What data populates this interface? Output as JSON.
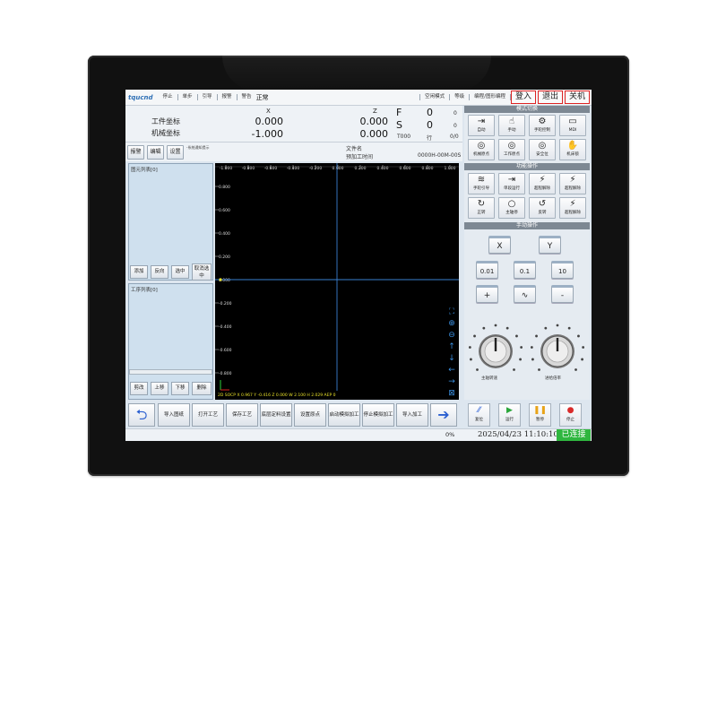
{
  "topbar": {
    "brand": "tqucnd",
    "items": [
      "停止",
      "单步",
      "引导",
      "报警",
      "警告"
    ],
    "state": "正常",
    "right_items": [
      "空闲模式",
      "等级",
      "编程/图形编程"
    ],
    "buttons": {
      "login": "登入",
      "exit": "退出",
      "shutdown": "关机"
    }
  },
  "coords": {
    "work_label": "工件坐标",
    "machine_label": "机械坐标",
    "x_header": "X",
    "z_header": "Z",
    "work_x": "0.000",
    "work_z": "0.000",
    "machine_x": "-1.000",
    "machine_z": "0.000",
    "f_label": "F",
    "f_value": "0",
    "f_unit": "0",
    "s_label": "S",
    "s_value": "0",
    "s_unit": "0",
    "t_label": "T000",
    "line_label": "行",
    "line_value": "0/0"
  },
  "row2": {
    "buttons": [
      "报警",
      "编辑",
      "设置"
    ],
    "system_note": "-系统通知提示",
    "file_label": "文件名",
    "time_label": "预加工时间",
    "time_value": "0000H-00M-00S"
  },
  "lists": {
    "element_title": "图元列表[0]",
    "element_buttons": [
      "添加",
      "反向",
      "选中",
      "取消选中"
    ],
    "process_title": "工序列表[0]",
    "process_buttons": [
      "剪改",
      "上移",
      "下移",
      "删除"
    ]
  },
  "canvas": {
    "x_ticks": [
      "-1.000",
      "-0.800",
      "-0.600",
      "-0.400",
      "-0.200",
      "0.000",
      "0.200",
      "0.400",
      "0.600",
      "0.800",
      "1.000"
    ],
    "y_ticks": [
      "0.800",
      "0.600",
      "0.400",
      "0.200",
      "0.000",
      "-0.200",
      "-0.400",
      "-0.600",
      "-0.800"
    ],
    "status": "2D SOCP X  0.967 Y  -0.416 Z    0.000 W    2.100 H    2.029 AEP 0"
  },
  "right": {
    "mode_title": "模式切换",
    "mode_buttons": [
      {
        "icon": "⇥",
        "label": "自动"
      },
      {
        "icon": "☝",
        "label": "手动"
      },
      {
        "icon": "⚙",
        "label": "手轮控制"
      },
      {
        "icon": "▭",
        "label": "MDI"
      },
      {
        "icon": "◎",
        "label": "机械原点"
      },
      {
        "icon": "◎",
        "label": "工作原点"
      },
      {
        "icon": "◎",
        "label": "安全位"
      },
      {
        "icon": "✋",
        "label": "机床锁"
      }
    ],
    "func_title": "功能操作",
    "func_buttons": [
      {
        "icon": "≋",
        "label": "手轮引导"
      },
      {
        "icon": "⇥",
        "label": "单段运行"
      },
      {
        "icon": "⚡",
        "label": "超程解除"
      },
      {
        "icon": "⚡",
        "label": "超程解除"
      },
      {
        "icon": "↻",
        "label": "正转"
      },
      {
        "icon": "○",
        "label": "主轴停"
      },
      {
        "icon": "↺",
        "label": "反转"
      },
      {
        "icon": "⚡",
        "label": "超程解除"
      }
    ],
    "manual_title": "手动操作",
    "axis_x": "X",
    "axis_y": "Y",
    "steps": [
      "0.01",
      "0.1",
      "10"
    ],
    "plus": "+",
    "wave": "∿",
    "minus": "-",
    "spindle_knob_label": "主轴转速",
    "feed_knob_label": "进给倍率"
  },
  "bottom": {
    "back_icon": "⮌",
    "buttons": [
      "导入图纸",
      "打开工艺",
      "保存工艺",
      "底层定料设置",
      "设置原点",
      "启动模拟加工",
      "停止模拟加工",
      "导入加工"
    ],
    "forward_icon": "➔",
    "run_buttons": [
      {
        "icon": "⁄⁄",
        "label": "复位",
        "color": "#2b5fd6"
      },
      {
        "icon": "▶",
        "label": "运行",
        "color": "#2aa63a"
      },
      {
        "icon": "❚❚",
        "label": "暂停",
        "color": "#e8a318"
      },
      {
        "icon": "●",
        "label": "停止",
        "color": "#d92a2a"
      }
    ]
  },
  "footer": {
    "progress": "0%",
    "datetime": "2025/04/23  11:10:10",
    "connection": "已连接"
  }
}
